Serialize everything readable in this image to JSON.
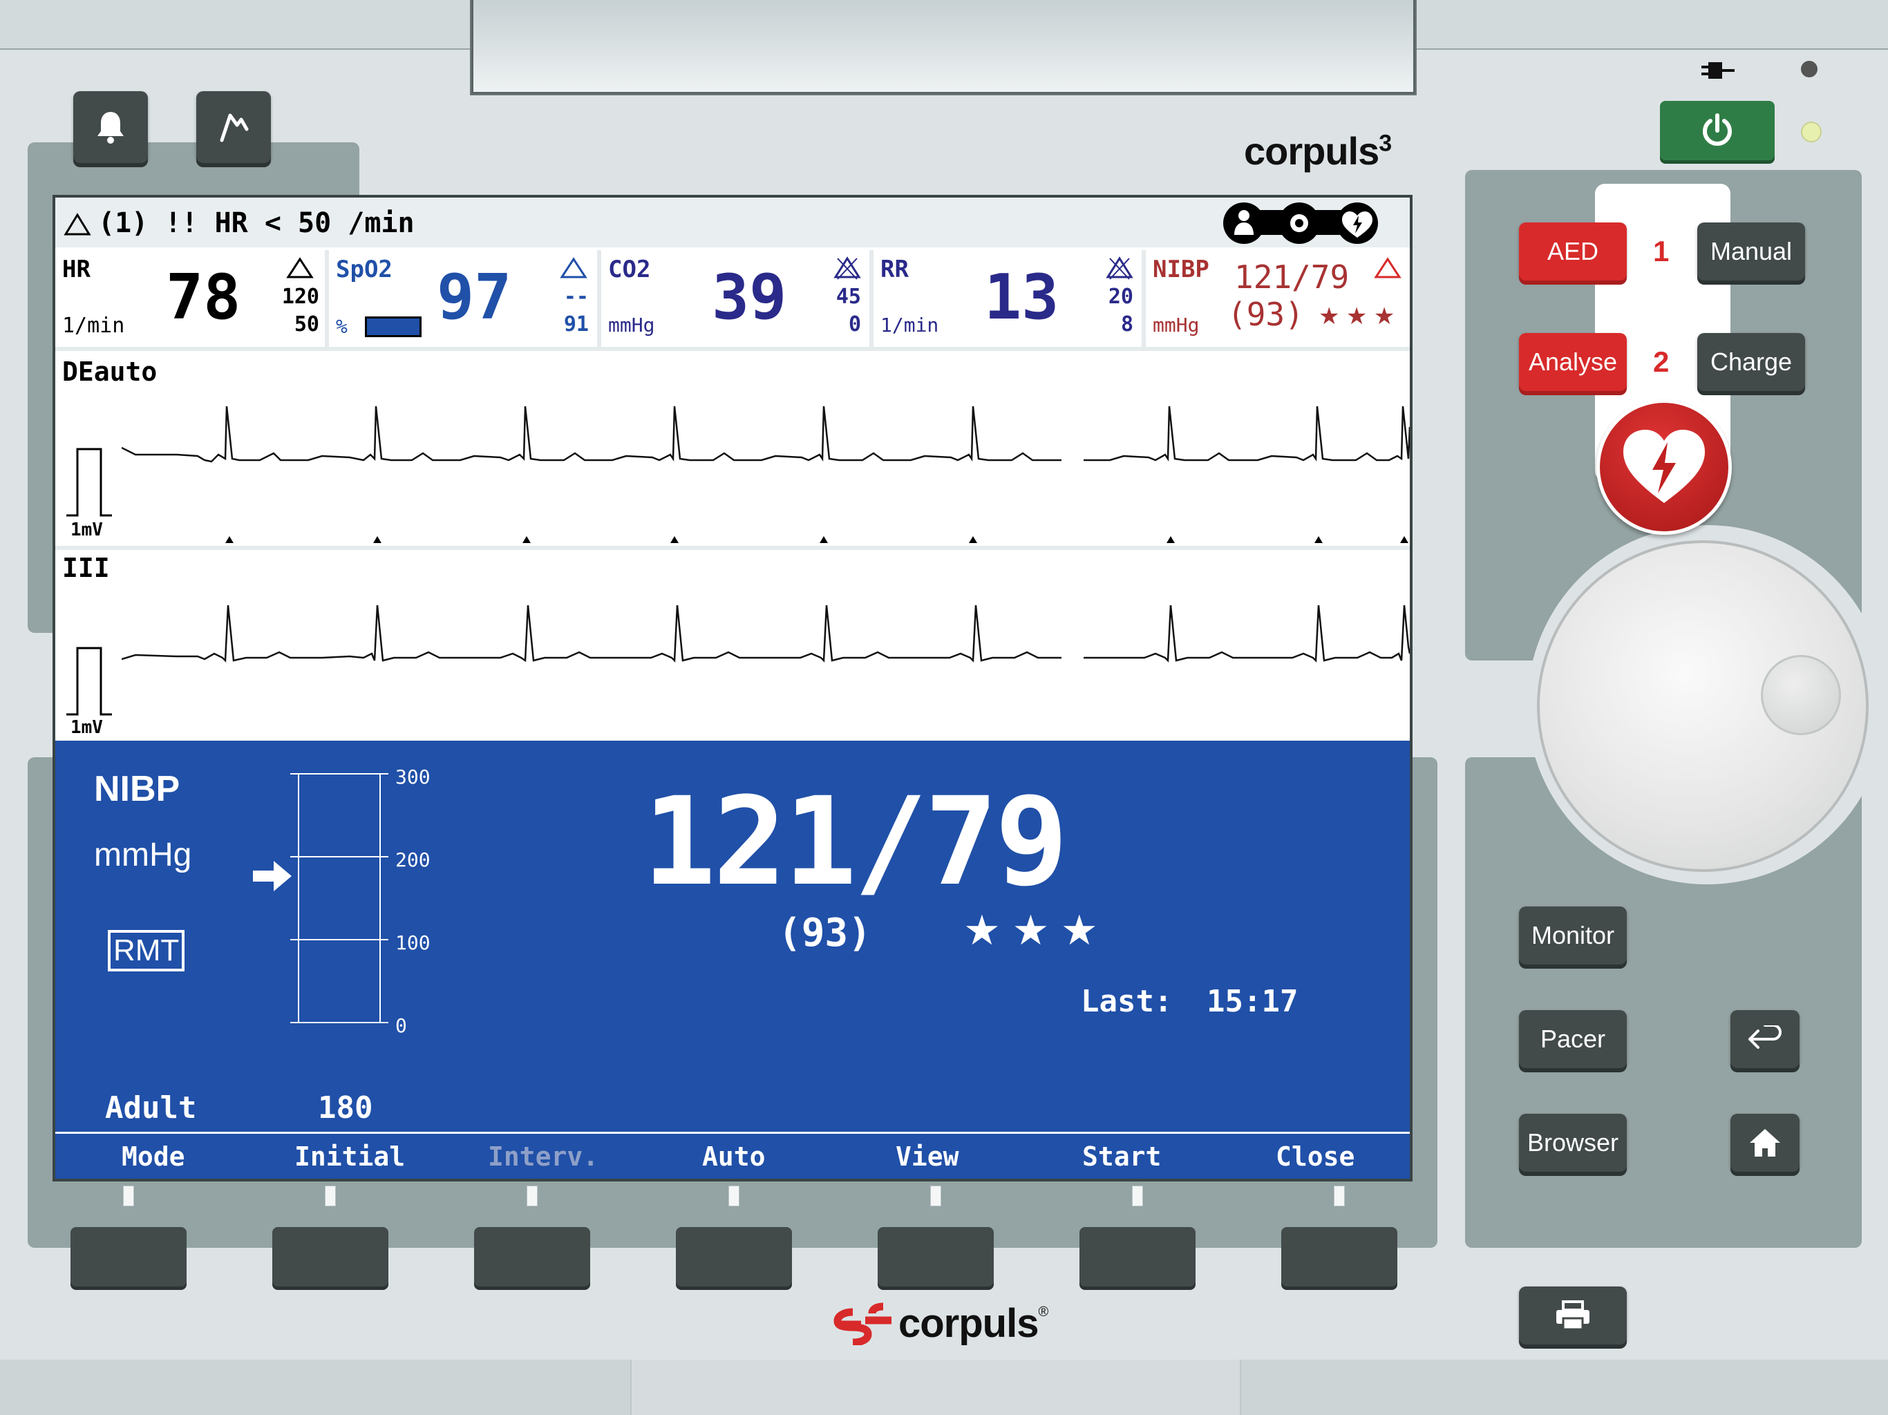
{
  "device": {
    "brand_top": "corpuls",
    "brand_top_sup": "3",
    "brand_bottom": "corpuls",
    "brand_bottom_reg": "®"
  },
  "alarm": {
    "text": "(1) !! HR < 50 /min"
  },
  "params": [
    {
      "label": "HR",
      "unit": "1/min",
      "value": "78",
      "limit_high": "120",
      "limit_low": "50",
      "color": "#000000"
    },
    {
      "label": "SpO2",
      "unit": "%",
      "value": "97",
      "limit_high": "--",
      "limit_low": "91",
      "color": "#2050a8"
    },
    {
      "label": "CO2",
      "unit": "mmHg",
      "value": "39",
      "limit_high": "45",
      "limit_low": "0",
      "color": "#2a2a8a"
    },
    {
      "label": "RR",
      "unit": "1/min",
      "value": "13",
      "limit_high": "20",
      "limit_low": "8",
      "color": "#2a2a8a"
    },
    {
      "label": "NIBP",
      "unit": "mmHg",
      "value": "121/79",
      "mean": "(93)",
      "stars": "★ ★ ★",
      "color": "#a83232"
    }
  ],
  "traces": [
    {
      "label": "DEauto",
      "cal": "1mV"
    },
    {
      "label": "III",
      "cal": "1mV"
    }
  ],
  "nibp": {
    "title": "NIBP",
    "unit": "mmHg",
    "mode_badge": "RMT",
    "scale": [
      "300",
      "200",
      "100",
      "0"
    ],
    "value": "121/79",
    "mean": "(93)",
    "stars": "★ ★ ★",
    "last_label": "Last:",
    "last_time": "15:17",
    "patient": "Adult",
    "initial_pressure": "180"
  },
  "softkeys": [
    {
      "label": "Mode",
      "enabled": true
    },
    {
      "label": "Initial",
      "enabled": true
    },
    {
      "label": "Interv.",
      "enabled": false
    },
    {
      "label": "Auto",
      "enabled": true
    },
    {
      "label": "View",
      "enabled": true
    },
    {
      "label": "Start",
      "enabled": true
    },
    {
      "label": "Close",
      "enabled": true
    }
  ],
  "side_buttons": {
    "aed": "AED",
    "manual": "Manual",
    "analyse": "Analyse",
    "charge": "Charge",
    "step1": "1",
    "step2": "2",
    "monitor": "Monitor",
    "pacer": "Pacer",
    "browser": "Browser"
  },
  "colors": {
    "accent_blue": "#2050a8",
    "alarm_red": "#d82a2a",
    "power_green": "#2f7d46"
  }
}
